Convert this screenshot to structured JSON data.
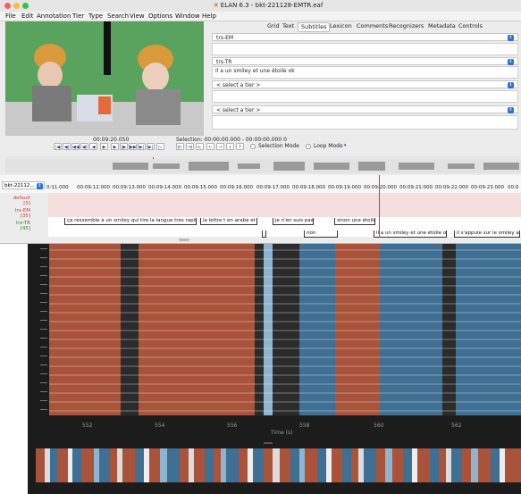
{
  "window": {
    "title": "ELAN 6.3 - bkt-221128-EMTR.eaf"
  },
  "menu": [
    "File",
    "Edit",
    "Annotation",
    "Tier",
    "Type",
    "Search",
    "View",
    "Options",
    "Window",
    "Help"
  ],
  "tabs": [
    "Grid",
    "Text",
    "Subtitles",
    "Lexicon",
    "Comments",
    "Recognizers",
    "Metadata",
    "Controls"
  ],
  "active_tab": "Subtitles",
  "subtitles": [
    {
      "tier": "trs-EM",
      "text": ""
    },
    {
      "tier": "trs-TR",
      "text": "il a un smiley et une étoile ok"
    },
    {
      "tier": "< select a tier >",
      "text": ""
    },
    {
      "tier": "< select a tier >",
      "text": ""
    }
  ],
  "player": {
    "time": "00:09:20.050",
    "selection": "Selection: 00:00:00.000 - 00:00:00.000  0",
    "selection_mode": "Selection Mode",
    "loop_mode": "Loop Mode"
  },
  "timeline": {
    "tier_select": "bkt-22112...",
    "ticks": [
      "0:11.000",
      "00:09:12.000",
      "00:09:13.000",
      "00:09:14.000",
      "00:09:15.000",
      "00:09:16.000",
      "00:09:17.000",
      "00:09:18.000",
      "00:09:19.000",
      "00:09:20.000",
      "00:09:21.000",
      "00:09:22.000",
      "00:09:23.000",
      "00:0"
    ],
    "tiers": [
      {
        "name": "default",
        "count": "[0]",
        "color": "#d23c3c"
      },
      {
        "name": "trs-EM",
        "count": "[35]",
        "color": "#d23c3c"
      },
      {
        "name": "trs-TR",
        "count": "[45]",
        "color": "#2c8a2c"
      }
    ],
    "annotations_em": [
      "ça ressemble à un smiley qui tire la langue très rapidemen",
      "la lettre t en arabe et",
      "je n'en suis pas sei",
      "sinon une étoile"
    ],
    "annotations_tr": [
      "non",
      "il a un smiley et une étoile ok",
      "il s'appuie sur le smiley arab"
    ]
  },
  "eeg": {
    "x_ticks": [
      "552",
      "554",
      "556",
      "558",
      "560",
      "562"
    ],
    "x_label": "Time (s)",
    "colors": {
      "orange": "#a9533a",
      "blue": "#3f6f92",
      "light_blue": "#8fb4cf",
      "dark": "#2b2b2b"
    }
  }
}
